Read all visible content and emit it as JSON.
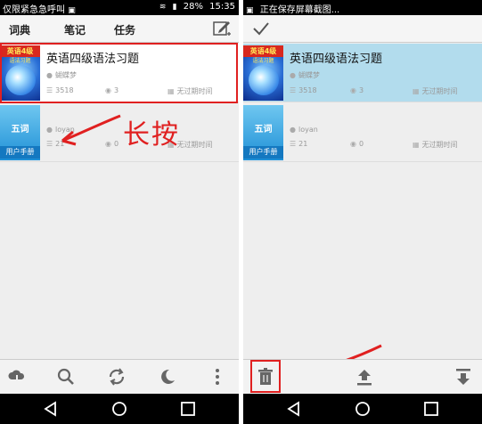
{
  "left": {
    "status": {
      "carrier": "仅限紧急急呼叫",
      "battery": "28%",
      "time": "15:35"
    },
    "tabs": [
      "词典",
      "笔记",
      "任务"
    ],
    "items": [
      {
        "title": "英语四级语法习题",
        "thumb_top": "英语4级",
        "thumb_sub": "语法习题",
        "author": "蝴蝶梦",
        "count": "3518",
        "views": "3",
        "expire": "无过期时间"
      },
      {
        "thumb_word": "五词",
        "thumb_footer": "用户手册",
        "author": "loyan",
        "count": "21",
        "views": "0",
        "expire": "无过期时间"
      }
    ],
    "annotation": "长按"
  },
  "right": {
    "status": {
      "notice": "正在保存屏幕截图..."
    },
    "items": [
      {
        "title": "英语四级语法习题",
        "thumb_top": "英语4级",
        "thumb_sub": "语法习题",
        "author": "蝴蝶梦",
        "count": "3518",
        "views": "3",
        "expire": "无过期时间"
      },
      {
        "thumb_word": "五词",
        "thumb_footer": "用户手册",
        "author": "loyan",
        "count": "21",
        "views": "0",
        "expire": "无过期时间"
      }
    ]
  },
  "colors": {
    "accent_red": "#e02020",
    "selected_bg": "#b2dced"
  },
  "icons": {
    "left_toolbar": [
      "cloud-download-icon",
      "search-icon",
      "sync-icon",
      "night-mode-icon",
      "more-icon"
    ],
    "right_toolbar": [
      "trash-icon",
      "upload-icon",
      "move-to-bottom-icon"
    ],
    "nav": [
      "back-icon",
      "home-icon",
      "recents-icon"
    ]
  }
}
